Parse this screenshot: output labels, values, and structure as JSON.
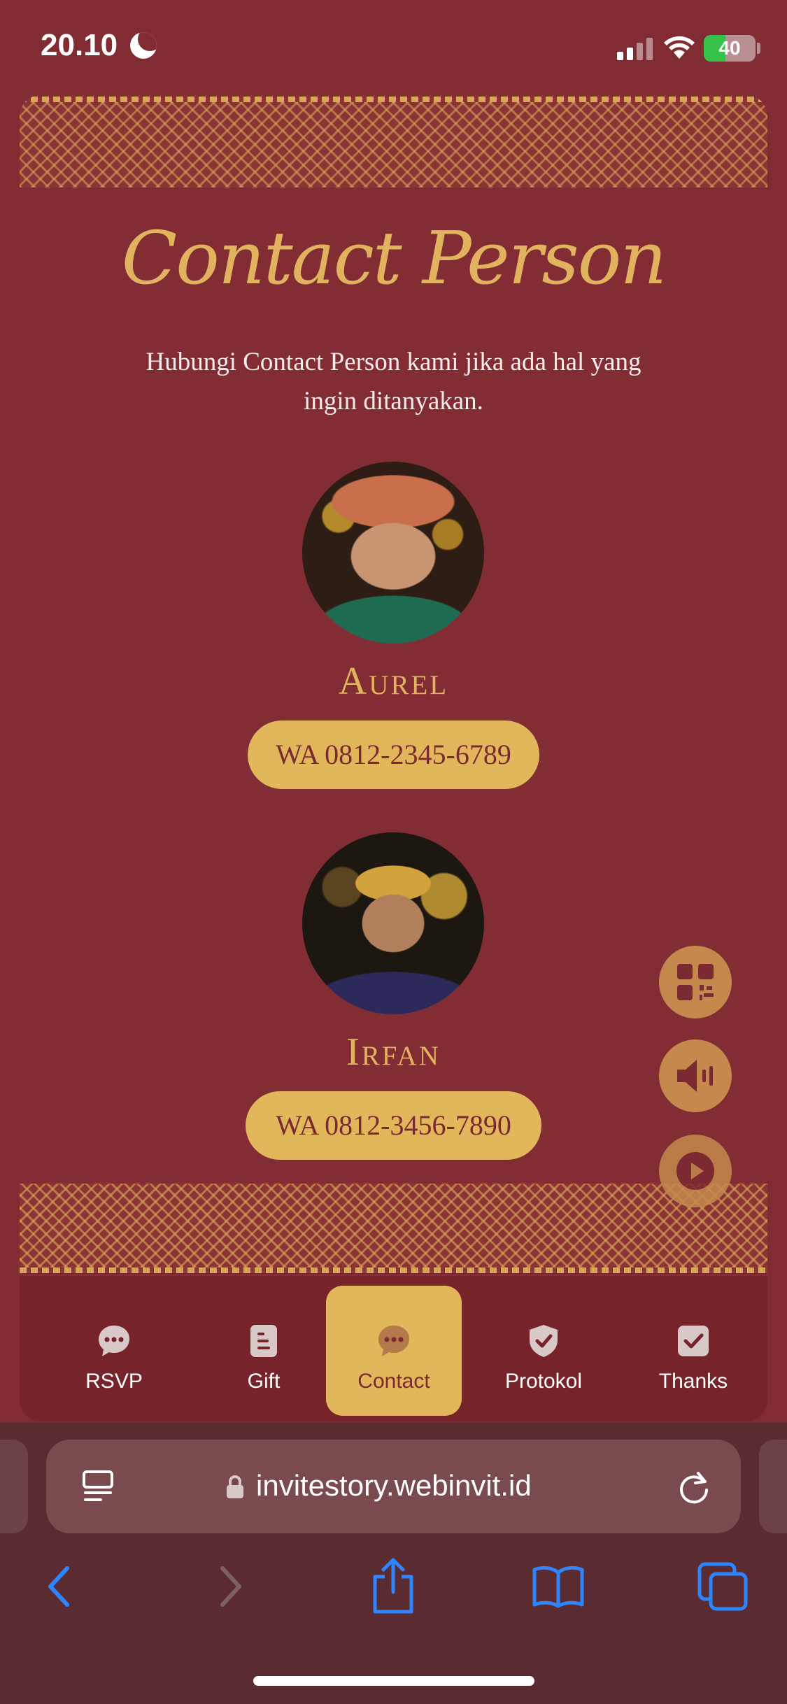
{
  "status_bar": {
    "time": "20.10",
    "battery": "40",
    "icons": [
      "moon-icon",
      "signal-icon",
      "wifi-icon",
      "battery-charging-icon"
    ]
  },
  "section": {
    "title": "Contact Person",
    "subtitle": "Hubungi Contact Person kami jika ada hal yang ingin ditanyakan."
  },
  "contacts": [
    {
      "name": "Aurel",
      "button": "WA 0812-2345-6789"
    },
    {
      "name": "Irfan",
      "button": "WA 0812-3456-7890"
    }
  ],
  "floating_buttons": [
    "qr-code-icon",
    "speaker-icon",
    "play-icon"
  ],
  "bottom_nav": {
    "items": [
      {
        "label": "RSVP",
        "icon": "chat-bubble-icon",
        "active": false
      },
      {
        "label": "Gift",
        "icon": "document-icon",
        "active": false
      },
      {
        "label": "Contact",
        "icon": "chat-bubble-icon",
        "active": true
      },
      {
        "label": "Protokol",
        "icon": "shield-check-icon",
        "active": false
      },
      {
        "label": "Thanks",
        "icon": "check-square-icon",
        "active": false
      }
    ]
  },
  "browser": {
    "url": "invitestory.webinvit.id",
    "toolbar_icons": [
      "back-icon",
      "forward-icon",
      "share-icon",
      "bookmarks-icon",
      "tabs-icon"
    ]
  },
  "colors": {
    "background": "#812c33",
    "accent_gold": "#e2b75c",
    "nav_bg": "#76232a",
    "browser_chrome": "#5a2c31"
  }
}
